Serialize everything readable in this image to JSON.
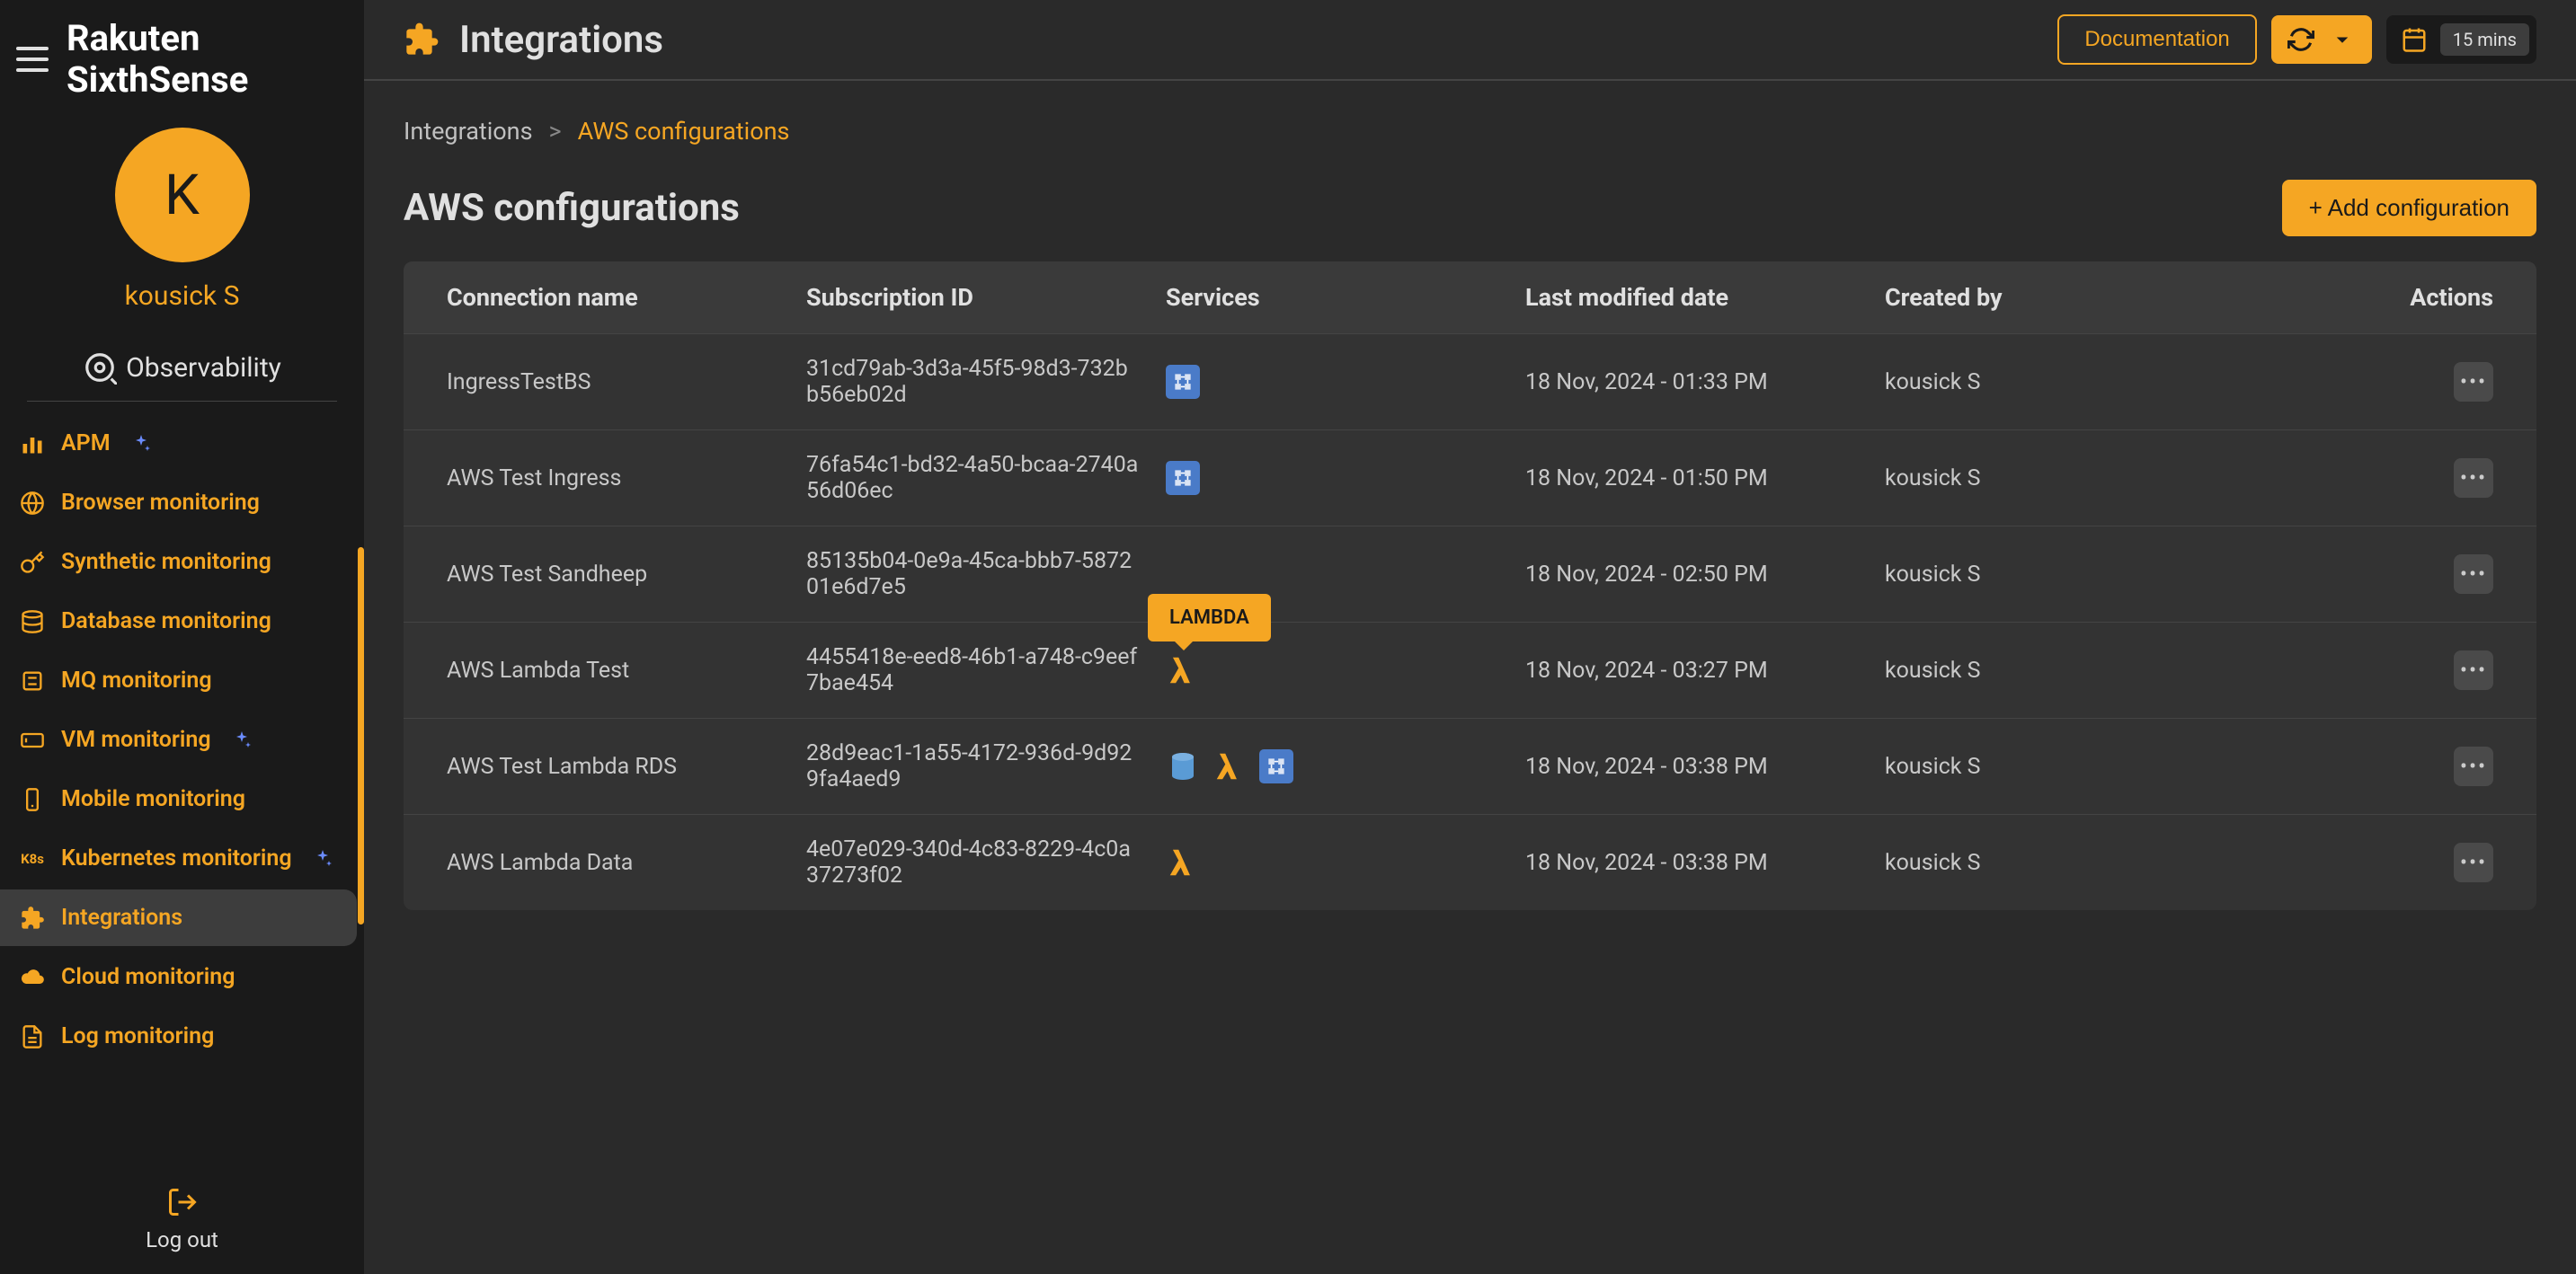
{
  "brand_line1": "Rakuten",
  "brand_line2": "SixthSense",
  "avatar_initial": "K",
  "username": "kousick S",
  "observability_label": "Observability",
  "nav_items": [
    {
      "label": "APM",
      "sparkle": true
    },
    {
      "label": "Browser monitoring",
      "sparkle": false
    },
    {
      "label": "Synthetic monitoring",
      "sparkle": false
    },
    {
      "label": "Database monitoring",
      "sparkle": false
    },
    {
      "label": "MQ monitoring",
      "sparkle": false
    },
    {
      "label": "VM monitoring",
      "sparkle": true
    },
    {
      "label": "Mobile monitoring",
      "sparkle": false
    },
    {
      "label": "Kubernetes monitoring",
      "sparkle": true
    },
    {
      "label": "Integrations",
      "sparkle": false
    },
    {
      "label": "Cloud monitoring",
      "sparkle": false
    },
    {
      "label": "Log monitoring",
      "sparkle": false
    }
  ],
  "active_nav_index": 8,
  "logout_label": "Log out",
  "topbar": {
    "title": "Integrations",
    "documentation": "Documentation",
    "time_range": "15 mins"
  },
  "breadcrumb": {
    "root": "Integrations",
    "sep": ">",
    "current": "AWS configurations"
  },
  "page_title": "AWS configurations",
  "add_button": "+ Add configuration",
  "columns": {
    "name": "Connection name",
    "sub": "Subscription ID",
    "services": "Services",
    "date": "Last modified date",
    "by": "Created by",
    "actions": "Actions"
  },
  "tooltip": "LAMBDA",
  "rows": [
    {
      "name": "IngressTestBS",
      "sub": "31cd79ab-3d3a-45f5-98d3-732bb56eb02d",
      "services": [
        "blue"
      ],
      "date": "18 Nov, 2024 - 01:33 PM",
      "by": "kousick S"
    },
    {
      "name": "AWS Test Ingress",
      "sub": "76fa54c1-bd32-4a50-bcaa-2740a56d06ec",
      "services": [
        "blue"
      ],
      "date": "18 Nov, 2024 - 01:50 PM",
      "by": "kousick S"
    },
    {
      "name": "AWS Test Sandheep",
      "sub": "85135b04-0e9a-45ca-bbb7-587201e6d7e5",
      "services": [],
      "date": "18 Nov, 2024 - 02:50 PM",
      "by": "kousick S"
    },
    {
      "name": "AWS Lambda Test",
      "sub": "4455418e-eed8-46b1-a748-c9eef7bae454",
      "services": [
        "lambda"
      ],
      "date": "18 Nov, 2024 - 03:27 PM",
      "by": "kousick S",
      "tooltip": true
    },
    {
      "name": "AWS Test Lambda RDS",
      "sub": "28d9eac1-1a55-4172-936d-9d929fa4aed9",
      "services": [
        "cyl",
        "lambda",
        "blue"
      ],
      "date": "18 Nov, 2024 - 03:38 PM",
      "by": "kousick S"
    },
    {
      "name": "AWS Lambda Data",
      "sub": "4e07e029-340d-4c83-8229-4c0a37273f02",
      "services": [
        "lambda"
      ],
      "date": "18 Nov, 2024 - 03:38 PM",
      "by": "kousick S"
    }
  ]
}
